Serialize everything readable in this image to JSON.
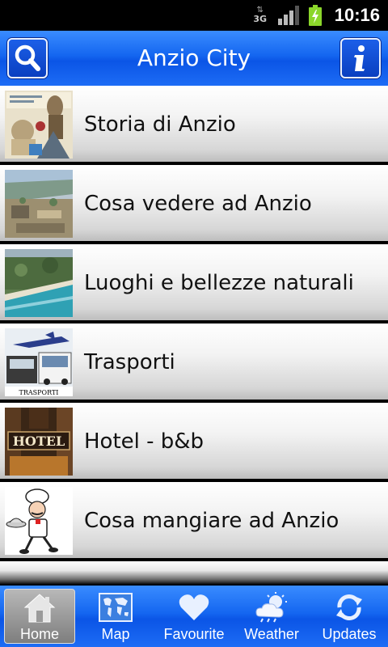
{
  "status_bar": {
    "network": "3G",
    "time": "10:16"
  },
  "header": {
    "title": "Anzio City",
    "left_icon": "search-icon",
    "right_icon": "info-icon"
  },
  "menu": {
    "items": [
      {
        "label": "Storia di Anzio",
        "thumb": "history-collage-thumbnail"
      },
      {
        "label": "Cosa vedere ad Anzio",
        "thumb": "archaeological-site-thumbnail"
      },
      {
        "label": "Luoghi e bellezze naturali",
        "thumb": "coastline-thumbnail"
      },
      {
        "label": "Trasporti",
        "thumb": "transport-thumbnail",
        "thumb_caption": "TRASPORTI"
      },
      {
        "label": "Hotel - b&b",
        "thumb": "hotel-sign-thumbnail",
        "thumb_caption": "HOTEL"
      },
      {
        "label": "Cosa mangiare ad Anzio",
        "thumb": "chef-thumbnail"
      }
    ]
  },
  "tabs": [
    {
      "label": "Home",
      "icon": "home-icon",
      "active": true
    },
    {
      "label": "Map",
      "icon": "world-map-icon",
      "active": false
    },
    {
      "label": "Favourite",
      "icon": "heart-icon",
      "active": false
    },
    {
      "label": "Weather",
      "icon": "weather-icon",
      "active": false
    },
    {
      "label": "Updates",
      "icon": "refresh-icon",
      "active": false
    }
  ],
  "colors": {
    "bar_blue": "#1466f0",
    "item_light": "#ffffff",
    "item_dark": "#bdbdbd",
    "active_tab": "#9a9a9a"
  }
}
